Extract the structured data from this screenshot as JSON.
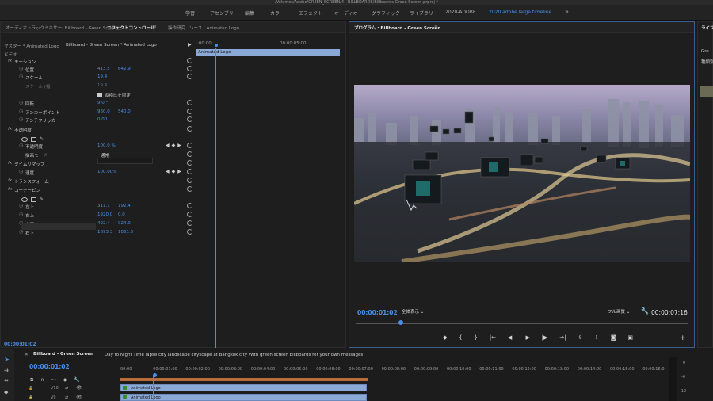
{
  "title_path": "/Volumes/Adobe/GREEN_SCREEN/4 - BILLBOARDS/Billboards Green Screen.prproj *",
  "workspaces": [
    "学習",
    "アセンブリ",
    "編集",
    "カラー",
    "エフェクト",
    "オーディオ",
    "グラフィック",
    "ライブラリ",
    "2020-ADOBE",
    "2020 adobe large timeline",
    "»"
  ],
  "effects_panel": {
    "tabs": [
      "オーディオトラックミキサー: Billboard - Green Screen",
      "エフェクトコントロール",
      "≡",
      "操作研究",
      "ソース : Animated Logo"
    ],
    "master_label": "マスター * Animated Logo",
    "clip_label": "Billboard - Green Screen * Animated Logo",
    "video_label": "ビデオ",
    "ruler_start": ":00:00",
    "ruler_end": "00:00:05:00",
    "clip_name": "Animated Logo",
    "rows": [
      {
        "label": "モーション",
        "v1": "",
        "v2": ""
      },
      {
        "label": "位置",
        "v1": "413.5",
        "v2": "642.9"
      },
      {
        "label": "スケール",
        "v1": "19.4",
        "v2": ""
      },
      {
        "label": "スケール (幅)",
        "v1": "19.4",
        "v2": ""
      },
      {
        "label": "縦横比を固定",
        "v1": "",
        "v2": ""
      },
      {
        "label": "回転",
        "v1": "9.0 °",
        "v2": ""
      },
      {
        "label": "アンカーポイント",
        "v1": "960.0",
        "v2": "540.0"
      },
      {
        "label": "アンチフリッカー",
        "v1": "0.00",
        "v2": ""
      },
      {
        "label": "不透明度",
        "v1": "",
        "v2": ""
      },
      {
        "label": "不透明度",
        "v1": "100.0 %",
        "v2": ""
      },
      {
        "label": "描画モード",
        "v1": "通常",
        "v2": ""
      },
      {
        "label": "タイムリマップ",
        "v1": "",
        "v2": ""
      },
      {
        "label": "速度",
        "v1": "100.00%",
        "v2": ""
      },
      {
        "label": "トランスフォーム",
        "v1": "",
        "v2": ""
      },
      {
        "label": "コーナーピン",
        "v1": "",
        "v2": ""
      },
      {
        "label": "左上",
        "v1": "311.1",
        "v2": "192.4"
      },
      {
        "label": "右上",
        "v1": "1920.0",
        "v2": "0.0"
      },
      {
        "label": "左下",
        "v1": "492.4",
        "v2": "924.0"
      },
      {
        "label": "右下",
        "v1": "1693.3",
        "v2": "1061.5"
      }
    ],
    "timecode": "00:00:01:02"
  },
  "program": {
    "tab": "プログラム : Billboard - Green Screen",
    "timecode": "00:00:01:02",
    "fit": "全体表示",
    "quality": "フル画質",
    "duration": "00:00:07:16"
  },
  "right_panel": {
    "tab": "ライブ",
    "search": "Gre",
    "header": "種類別"
  },
  "timeline": {
    "tab": "Billboard - Green Screen",
    "description": "Day to Night Time lapse city landscape cityscape at Bangkok city With green screen billboards for your own messages",
    "timecode": "00:00:01:02",
    "ruler": [
      "00:00",
      "00:00:01:00",
      "00:00:02:00",
      "00:00:03:00",
      "00:00:04:00",
      "00:00:05:00",
      "00:00:06:00",
      "00:00:07:00",
      "00:00:08:00",
      "00:00:09:00",
      "00:00:10:00",
      "00:00:11:00",
      "00:00:12:00",
      "00:00:13:00",
      "00:00:14:00",
      "00:00:15:00",
      "00:00:16:0"
    ],
    "tracks": [
      "V10",
      "V9"
    ],
    "clip": "Animated Logo",
    "meter": [
      "0",
      "-6",
      "-12"
    ]
  },
  "colors": {
    "accent": "#4a8fe7",
    "panel": "#1e1e1e",
    "clip": "#8aa9d6"
  }
}
